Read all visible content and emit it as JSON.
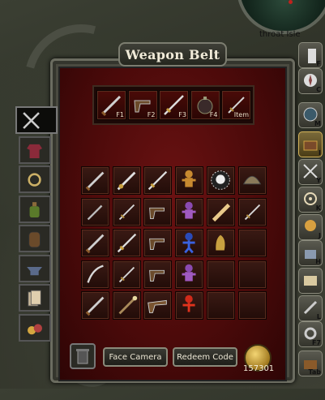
{
  "map": {
    "location_label": "throat Isle"
  },
  "window": {
    "title": "Weapon Belt"
  },
  "quickbar": [
    {
      "key": "F1",
      "item_icon": "cutlass-icon"
    },
    {
      "key": "F2",
      "item_icon": "pistol-icon"
    },
    {
      "key": "F3",
      "item_icon": "sword-icon"
    },
    {
      "key": "F4",
      "item_icon": "grenade-icon"
    },
    {
      "key": "Item",
      "item_icon": "dagger-icon"
    }
  ],
  "inventory_rows": [
    [
      "cutlass-icon",
      "broadsword-icon",
      "sword-icon",
      "voodoo-doll-gold-icon",
      "skull-medallion-icon",
      "helmet-icon"
    ],
    [
      "knife-icon",
      "dagger-icon",
      "pistol-icon",
      "voodoo-doll-purple-icon",
      "wooden-staff-icon",
      "dagger-icon"
    ],
    [
      "cutlass-icon",
      "sword-icon",
      "pistol-icon",
      "voodoo-doll-blue-icon",
      "gold-hand-icon",
      "empty"
    ],
    [
      "sabre-icon",
      "dagger-icon",
      "pistol-icon",
      "voodoo-doll-purple-icon",
      "empty",
      "empty"
    ],
    [
      "cutlass-icon",
      "staff-icon",
      "blunderbuss-icon",
      "voodoo-doll-red-icon",
      "empty",
      "empty"
    ]
  ],
  "left_tabs": [
    {
      "icon": "crossed-weapons-icon",
      "active": true
    },
    {
      "icon": "clothing-icon",
      "active": false
    },
    {
      "icon": "jewelry-icon",
      "active": false
    },
    {
      "icon": "potion-icon",
      "active": false
    },
    {
      "icon": "barrel-icon",
      "active": false
    },
    {
      "icon": "anvil-icon",
      "active": false
    },
    {
      "icon": "cards-icon",
      "active": false
    },
    {
      "icon": "treasure-icon",
      "active": false
    }
  ],
  "right_tabs": [
    {
      "icon": "tower-icon",
      "key": "F"
    },
    {
      "icon": "compass-icon",
      "key": "C"
    },
    {
      "icon": "map-icon",
      "key": "M"
    },
    {
      "icon": "chest-icon",
      "key": "I",
      "active": true
    },
    {
      "icon": "crossed-swords-icon",
      "key": "Y"
    },
    {
      "icon": "ship-wheel-icon",
      "key": "K"
    },
    {
      "icon": "skull-icon",
      "key": "J"
    },
    {
      "icon": "castle-icon",
      "key": "H"
    },
    {
      "icon": "book-icon",
      "key": ""
    },
    {
      "icon": "spyglass-icon",
      "key": "L"
    },
    {
      "icon": "gears-icon",
      "key": "F7"
    },
    {
      "icon": "treasure-chest-icon",
      "key": "Tab"
    }
  ],
  "buttons": {
    "face_camera": "Face Camera",
    "redeem_code": "Redeem Code"
  },
  "gold": {
    "amount": "157301",
    "icon": "gold-coin-icon"
  }
}
